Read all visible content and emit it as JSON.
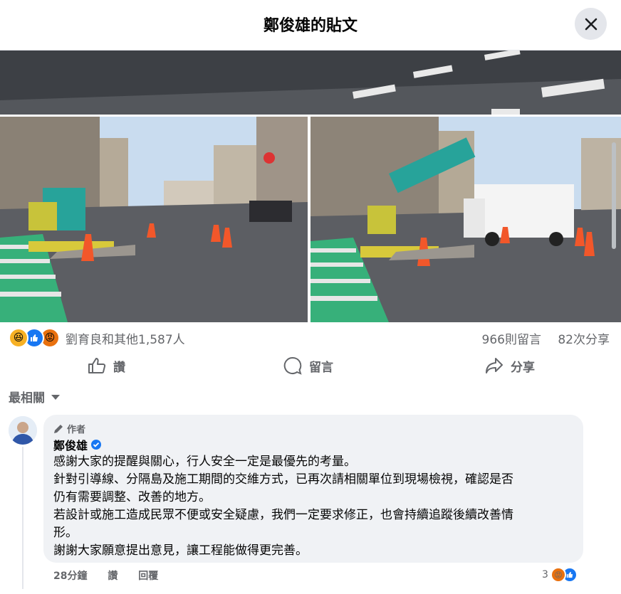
{
  "dialog": {
    "title": "鄭俊雄的貼文"
  },
  "post": {
    "reactions_text": "劉育良和其他1,587人",
    "comments_count": "966則留言",
    "shares_count": "82次分享",
    "actions": {
      "like": "讚",
      "comment": "留言",
      "share": "分享"
    }
  },
  "comments_sort": "最相關",
  "comment": {
    "author_badge": "作者",
    "author_name": "鄭俊雄",
    "lines": [
      "感謝大家的提醒與關心，行人安全一定是最優先的考量。",
      "針對引導線、分隔島及施工期間的交維方式，已再次請相關單位到現場檢視，確認是否",
      "仍有需要調整、改善的地方。",
      "若設計或施工造成民眾不便或安全疑慮，我們一定要求修正，也會持續追蹤後續改善情",
      "形。",
      "謝謝大家願意提出意見，讓工程能做得更完善。"
    ],
    "time": "28分鐘",
    "like_label": "讚",
    "reply_label": "回覆",
    "reaction_count": "3"
  },
  "colors": {
    "accent": "#1877f2",
    "traffic_green": "#2fb57d",
    "cone_orange": "#f2572a"
  }
}
